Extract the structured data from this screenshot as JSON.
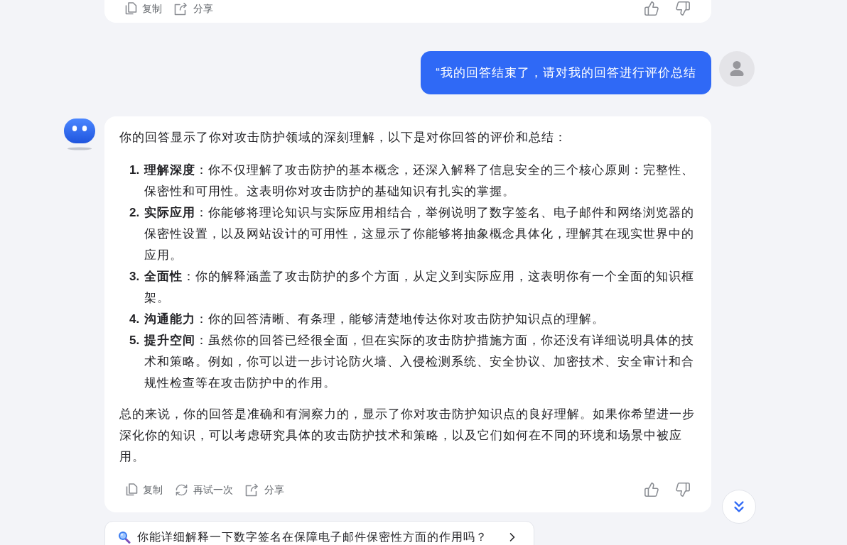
{
  "previous_message": {
    "actions": [
      {
        "kind": "copy",
        "label": "复制"
      },
      {
        "kind": "share",
        "label": "分享"
      }
    ]
  },
  "user_message": {
    "text": "“我的回答结束了，请对我的回答进行评价总结"
  },
  "assistant_message": {
    "intro": "你的回答显示了你对攻击防护领域的深刻理解，以下是对你回答的评价和总结：",
    "points": [
      {
        "number": "1.",
        "text": "**理解深度**：你不仅理解了攻击防护的基本概念，还深入解释了信息安全的三个核心原则：完整性、保密性和可用性。这表明你对攻击防护的基础知识有扎实的掌握。"
      },
      {
        "number": "2.",
        "text": "**实际应用**：你能够将理论知识与实际应用相结合，举例说明了数字签名、电子邮件和网络浏览器的保密性设置，以及网站设计的可用性，这显示了你能够将抽象概念具体化，理解其在现实世界中的应用。"
      },
      {
        "number": "3.",
        "text": "**全面性**：你的解释涵盖了攻击防护的多个方面，从定义到实际应用，这表明你有一个全面的知识框架。"
      },
      {
        "number": "4.",
        "text": "**沟通能力**：你的回答清晰、有条理，能够清楚地传达你对攻击防护知识点的理解。"
      },
      {
        "number": "5.",
        "text": "**提升空间**：虽然你的回答已经很全面，但在实际的攻击防护措施方面，你还没有详细说明具体的技术和策略。例如，你可以进一步讨论防火墙、入侵检测系统、安全协议、加密技术、安全审计和合规性检查等在攻击防护中的作用。"
      }
    ],
    "conclusion": "总的来说，你的回答是准确和有洞察力的，显示了你对攻击防护知识点的良好理解。如果你希望进一步深化你的知识，可以考虑研究具体的攻击防护技术和策略，以及它们如何在不同的环境和场景中被应用。",
    "actions": [
      {
        "kind": "copy",
        "label": "复制"
      },
      {
        "kind": "retry",
        "label": "再试一次"
      },
      {
        "kind": "share",
        "label": "分享"
      }
    ]
  },
  "suggestion": {
    "text": "你能详细解释一下数字签名在保障电子邮件保密性方面的作用吗？"
  }
}
